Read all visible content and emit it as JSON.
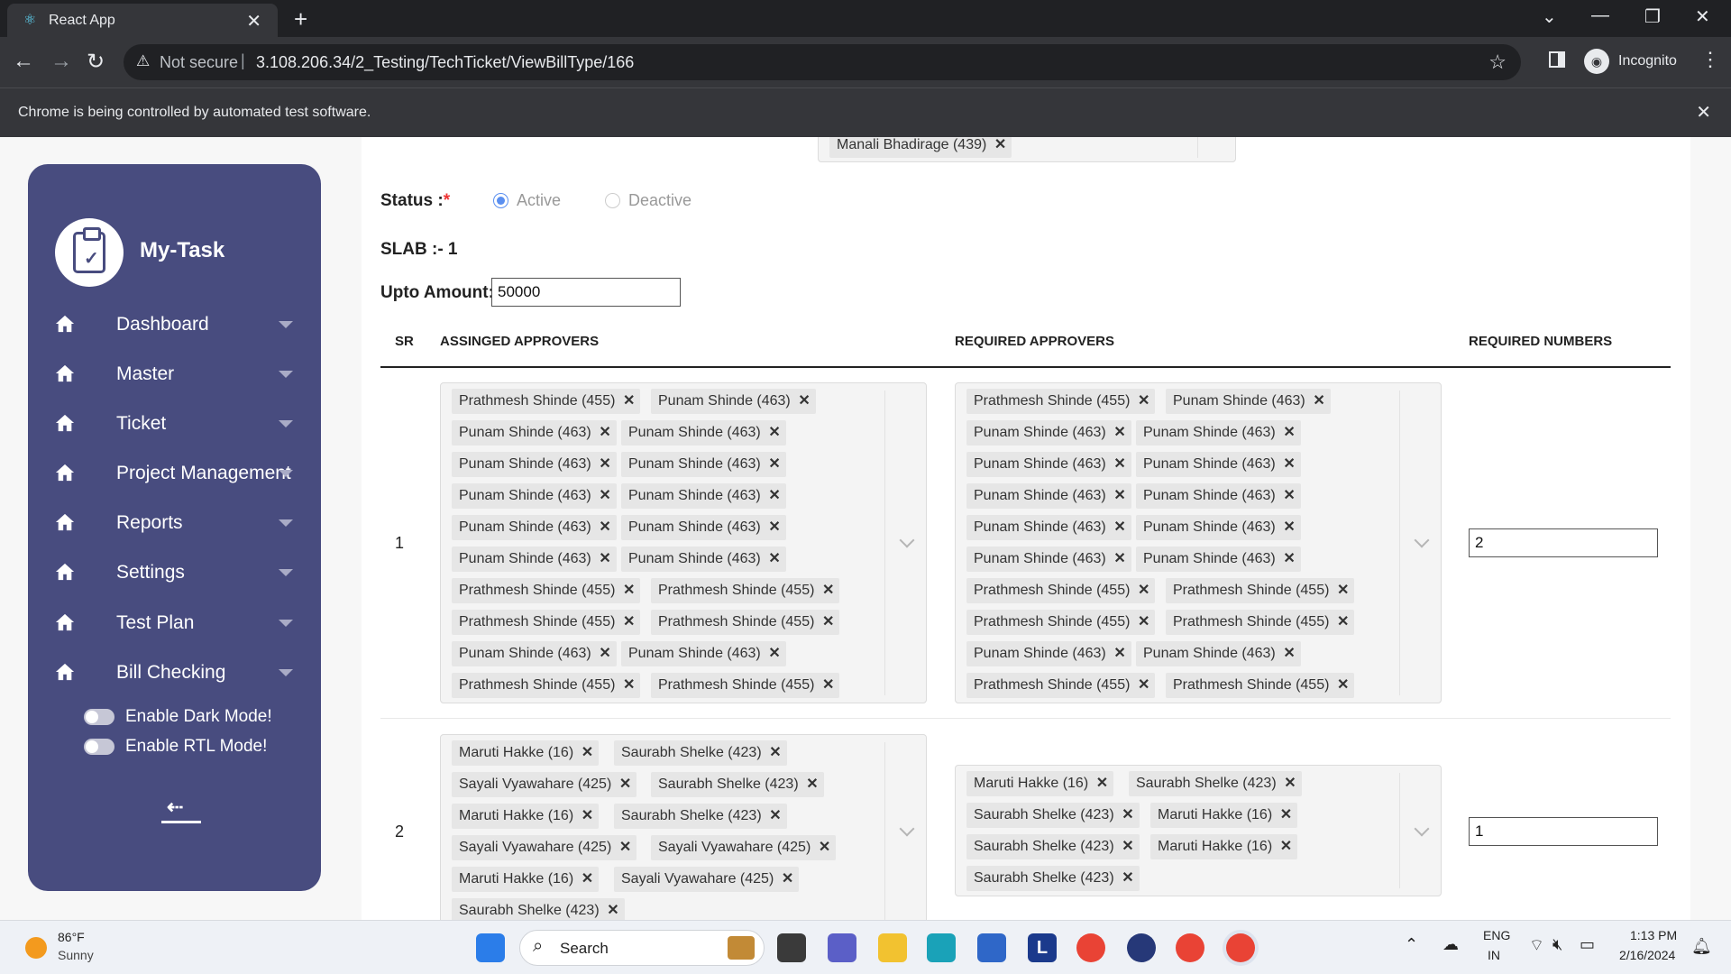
{
  "browser": {
    "tab_title": "React App",
    "tab_close": "✕",
    "new_tab": "+",
    "not_secure": "Not secure",
    "url": "3.108.206.34/2_Testing/TechTicket/ViewBillType/166",
    "profile": "Incognito",
    "infobar": "Chrome is being controlled by automated test software."
  },
  "sidebar": {
    "brand": "My-Task",
    "items": [
      {
        "label": "Dashboard"
      },
      {
        "label": "Master"
      },
      {
        "label": "Ticket"
      },
      {
        "label": "Project Management"
      },
      {
        "label": "Reports"
      },
      {
        "label": "Settings"
      },
      {
        "label": "Test Plan"
      },
      {
        "label": "Bill Checking"
      }
    ],
    "dark_mode": "Enable Dark Mode!",
    "rtl_mode": "Enable RTL Mode!"
  },
  "form": {
    "top_chip": "Manali Bhadirage (439)",
    "status_label": "Status :",
    "required_mark": "*",
    "status_options": [
      "Active",
      "Deactive"
    ],
    "status_selected": "Active",
    "slab_label": "SLAB :- 1",
    "upto_label": "Upto Amount:",
    "upto_value": "50000"
  },
  "table": {
    "headers": [
      "SR",
      "ASSINGED APPROVERS",
      "REQUIRED APPROVERS",
      "REQUIRED NUMBERS"
    ],
    "rows": [
      {
        "sr": "1",
        "assigned": [
          "Prathmesh Shinde (455)",
          "Punam Shinde (463)",
          "Punam Shinde (463)",
          "Punam Shinde (463)",
          "Punam Shinde (463)",
          "Punam Shinde (463)",
          "Punam Shinde (463)",
          "Punam Shinde (463)",
          "Punam Shinde (463)",
          "Punam Shinde (463)",
          "Punam Shinde (463)",
          "Punam Shinde (463)",
          "Prathmesh Shinde (455)",
          "Prathmesh Shinde (455)",
          "Prathmesh Shinde (455)",
          "Prathmesh Shinde (455)",
          "Punam Shinde (463)",
          "Punam Shinde (463)",
          "Prathmesh Shinde (455)",
          "Prathmesh Shinde (455)"
        ],
        "required": [
          "Prathmesh Shinde (455)",
          "Punam Shinde (463)",
          "Punam Shinde (463)",
          "Punam Shinde (463)",
          "Punam Shinde (463)",
          "Punam Shinde (463)",
          "Punam Shinde (463)",
          "Punam Shinde (463)",
          "Punam Shinde (463)",
          "Punam Shinde (463)",
          "Punam Shinde (463)",
          "Punam Shinde (463)",
          "Prathmesh Shinde (455)",
          "Prathmesh Shinde (455)",
          "Prathmesh Shinde (455)",
          "Prathmesh Shinde (455)",
          "Punam Shinde (463)",
          "Punam Shinde (463)",
          "Prathmesh Shinde (455)",
          "Prathmesh Shinde (455)"
        ],
        "required_number": "2"
      },
      {
        "sr": "2",
        "assigned": [
          "Maruti Hakke (16)",
          "Saurabh Shelke (423)",
          "Sayali Vyawahare (425)",
          "Saurabh Shelke (423)",
          "Maruti Hakke (16)",
          "Saurabh Shelke (423)",
          "Sayali Vyawahare (425)",
          "Sayali Vyawahare (425)",
          "Maruti Hakke (16)",
          "Sayali Vyawahare (425)",
          "Saurabh Shelke (423)"
        ],
        "required": [
          "Maruti Hakke (16)",
          "Saurabh Shelke (423)",
          "Saurabh Shelke (423)",
          "Maruti Hakke (16)",
          "Saurabh Shelke (423)",
          "Maruti Hakke (16)",
          "Saurabh Shelke (423)"
        ],
        "required_number": "1"
      }
    ]
  },
  "taskbar": {
    "temp": "86°F",
    "condition": "Sunny",
    "search": "Search",
    "lang": "ENG",
    "region": "IN",
    "time": "1:13 PM",
    "date": "2/16/2024"
  }
}
